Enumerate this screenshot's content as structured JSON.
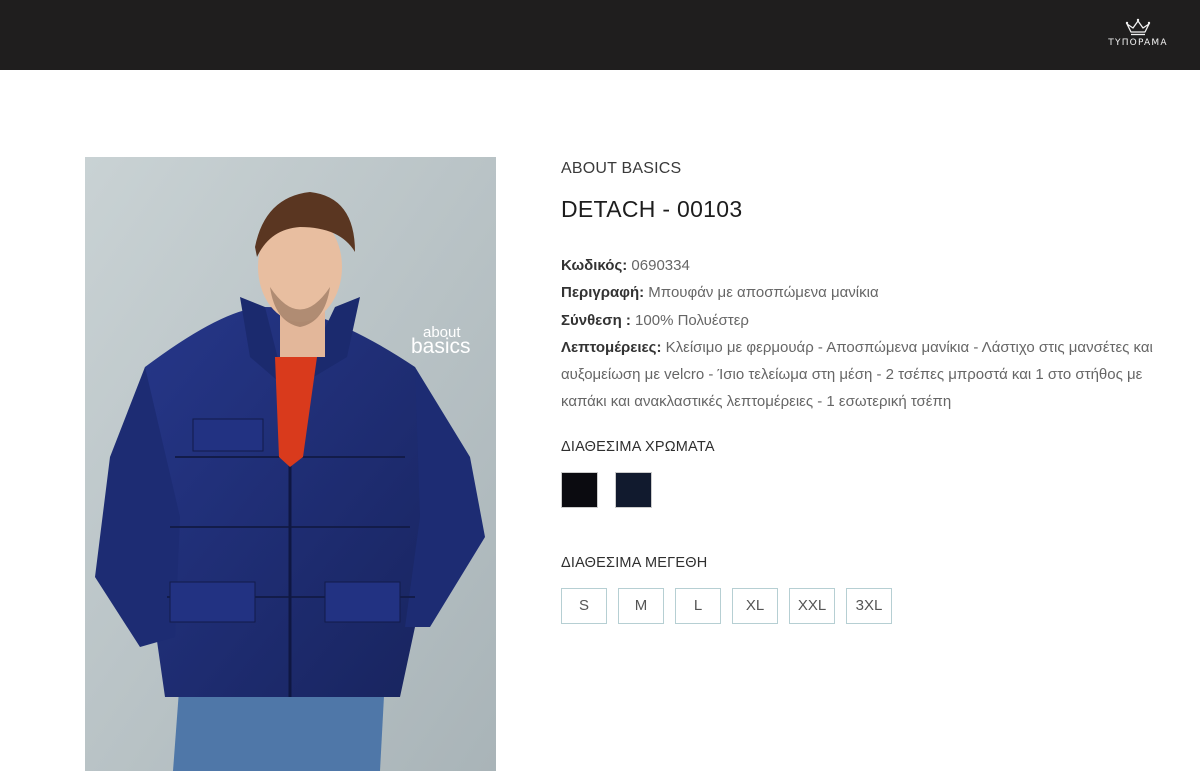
{
  "header": {
    "logo_text": "TYΠOPAMA"
  },
  "image": {
    "alt": "Man wearing a navy detachable-sleeve jacket",
    "watermark_line1": "about",
    "watermark_line2": "basics"
  },
  "product": {
    "brand": "ABOUT BASICS",
    "title": "DETACH - 00103",
    "code_label": "Κωδικός:",
    "code_value": " 0690334",
    "description_label": "Περιγραφή:",
    "description_value": " Μπουφάν με αποσπώμενα μανίκια",
    "composition_label": "Σύνθεση :",
    "composition_value": " 100% Πολυέστερ",
    "details_label": "Λεπτομέρειες:",
    "details_value": " Κλείσιμο με φερμουάρ - Αποσπώμενα μανίκια - Λάστιχο στις μανσέτες και αυξομείωση με velcro - Ίσιο τελείωμα στη μέση - 2 τσέπες μπροστά και 1 στο στήθος με καπάκι και ανακλαστικές λεπτομέρειες - 1 εσωτερική τσέπη"
  },
  "colors": {
    "title": "ΔΙΑΘΕΣΙΜΑ ΧΡΩΜΑΤΑ",
    "items": [
      {
        "name": "black",
        "hex": "#0b0b10"
      },
      {
        "name": "navy",
        "hex": "#111a2e"
      }
    ]
  },
  "sizes": {
    "title": "ΔΙΑΘΕΣΙΜΑ ΜΕΓΕΘΗ",
    "items": [
      "S",
      "M",
      "L",
      "XL",
      "XXL",
      "3XL"
    ]
  }
}
